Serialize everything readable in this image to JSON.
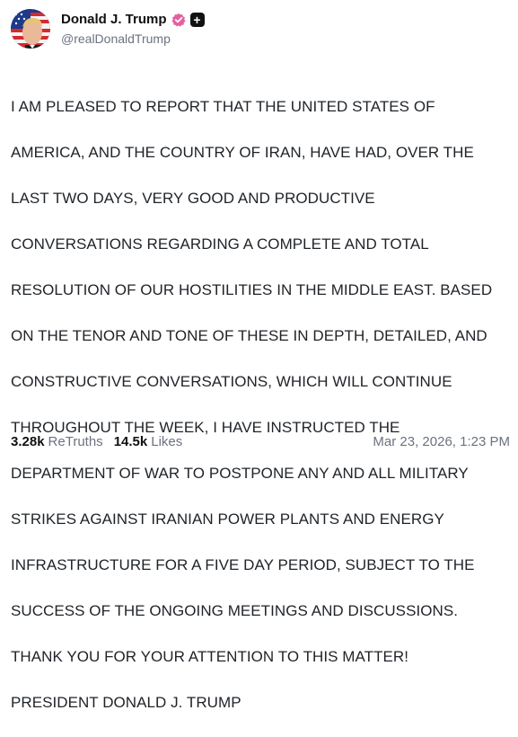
{
  "author": {
    "display_name": "Donald J. Trump",
    "handle": "@realDonaldTrump",
    "verified_badge_color": "#e55fa0",
    "follow_icon": "plus-icon",
    "follow_symbol": "+"
  },
  "post": {
    "lines": [
      "I AM PLEASED TO REPORT THAT THE UNITED STATES OF",
      "AMERICA, AND THE COUNTRY OF IRAN, HAVE HAD, OVER THE",
      "LAST TWO DAYS, VERY GOOD AND PRODUCTIVE",
      "CONVERSATIONS REGARDING A COMPLETE AND TOTAL",
      "RESOLUTION OF OUR HOSTILITIES IN THE MIDDLE EAST. BASED",
      "ON THE TENOR AND TONE OF THESE IN DEPTH, DETAILED, AND",
      "CONSTRUCTIVE CONVERSATIONS, WHICH WILL CONTINUE",
      "THROUGHOUT THE WEEK, I HAVE INSTRUCTED THE",
      "DEPARTMENT OF WAR TO POSTPONE ANY AND ALL MILITARY",
      "STRIKES AGAINST IRANIAN POWER PLANTS AND ENERGY",
      "INFRASTRUCTURE FOR A FIVE DAY PERIOD, SUBJECT TO THE",
      "SUCCESS OF THE ONGOING MEETINGS AND DISCUSSIONS.",
      "THANK YOU FOR YOUR ATTENTION TO THIS MATTER!",
      "PRESIDENT DONALD J. TRUMP"
    ]
  },
  "stats": {
    "retruths_count": "3.28k",
    "retruths_label": "ReTruths",
    "likes_count": "14.5k",
    "likes_label": "Likes"
  },
  "timestamp": "Mar 23, 2026, 1:23 PM"
}
